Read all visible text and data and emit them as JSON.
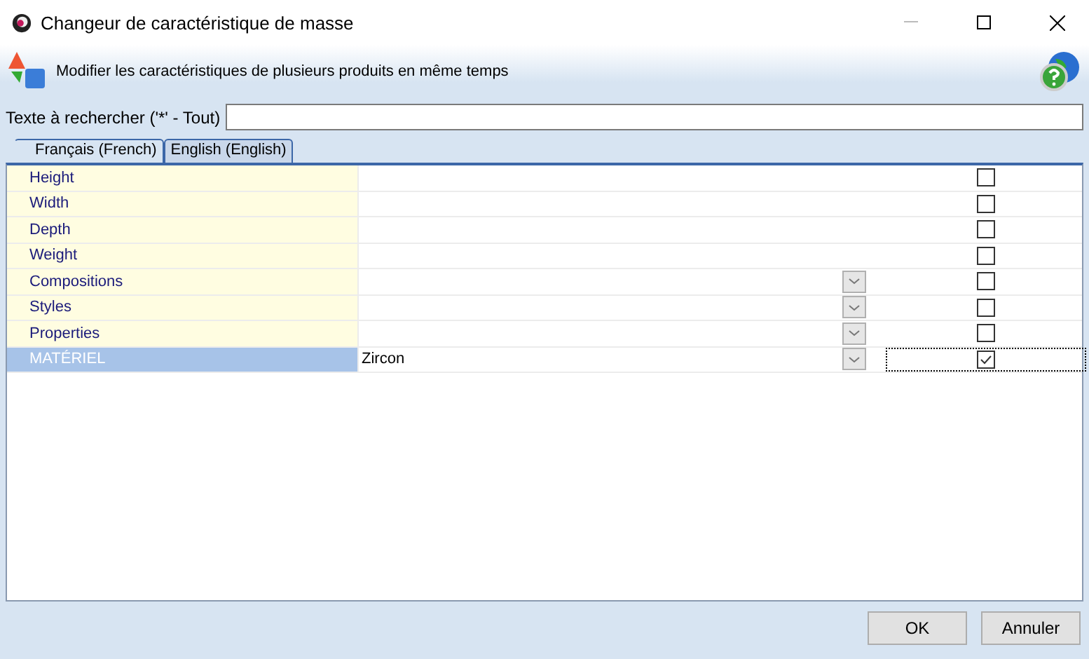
{
  "window": {
    "title": "Changeur de caractéristique de masse"
  },
  "header": {
    "text": "Modifier les caractéristiques de plusieurs produits en même temps"
  },
  "search": {
    "label": "Texte à rechercher ('*' - Tout)"
  },
  "tabs": [
    {
      "label": "Français (French)",
      "selected": true
    },
    {
      "label": "English (English)",
      "selected": false
    }
  ],
  "rows": [
    {
      "name": "Height",
      "kind": "text",
      "checked": false,
      "selected": false
    },
    {
      "name": "Width",
      "kind": "text",
      "checked": false,
      "selected": false
    },
    {
      "name": "Depth",
      "kind": "text",
      "checked": false,
      "selected": false
    },
    {
      "name": "Weight",
      "kind": "text",
      "checked": false,
      "selected": false
    },
    {
      "name": "Compositions",
      "kind": "dropdown",
      "checked": false,
      "selected": false
    },
    {
      "name": "Styles",
      "kind": "dropdown",
      "checked": false,
      "selected": false
    },
    {
      "name": "Properties",
      "kind": "dropdown",
      "checked": false,
      "selected": false
    },
    {
      "name": "MATÉRIEL",
      "value": "Zircon",
      "kind": "dropdown",
      "checked": true,
      "selected": true
    }
  ],
  "buttons": [
    "OK",
    "Annuler"
  ]
}
